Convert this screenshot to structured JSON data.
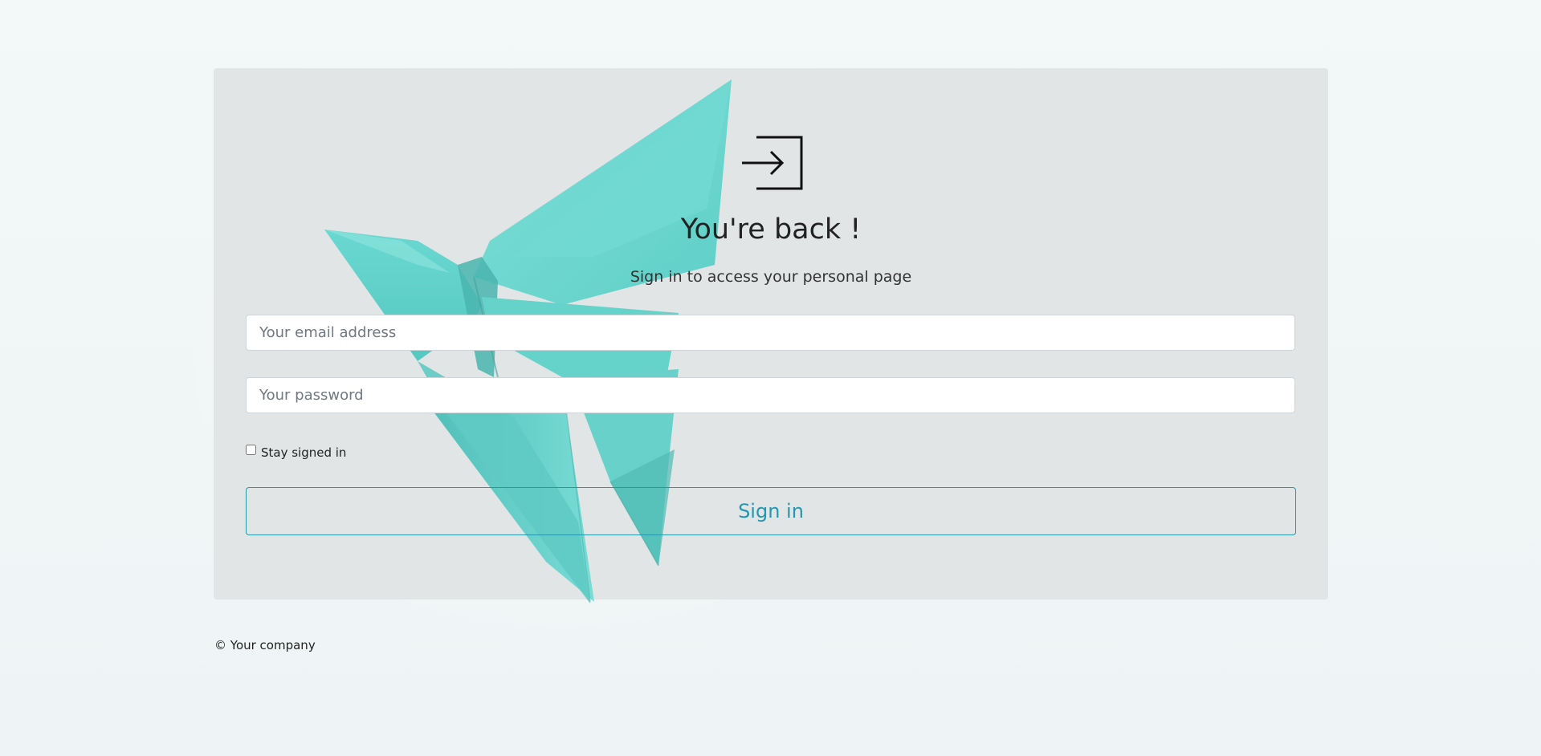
{
  "page": {
    "accent_color": "#2596ad",
    "panel_color": "#e2e5e6",
    "background_image": "teal-origami-butterfly"
  },
  "login": {
    "icon": "sign-in-arrow-icon",
    "title": "You're back !",
    "subtitle": "Sign in to access your personal page",
    "email_placeholder": "Your email address",
    "password_placeholder": "Your password",
    "remember_label": "Stay signed in",
    "remember_checked": false,
    "submit_label": "Sign in"
  },
  "footer": {
    "copyright": "© Your company"
  }
}
